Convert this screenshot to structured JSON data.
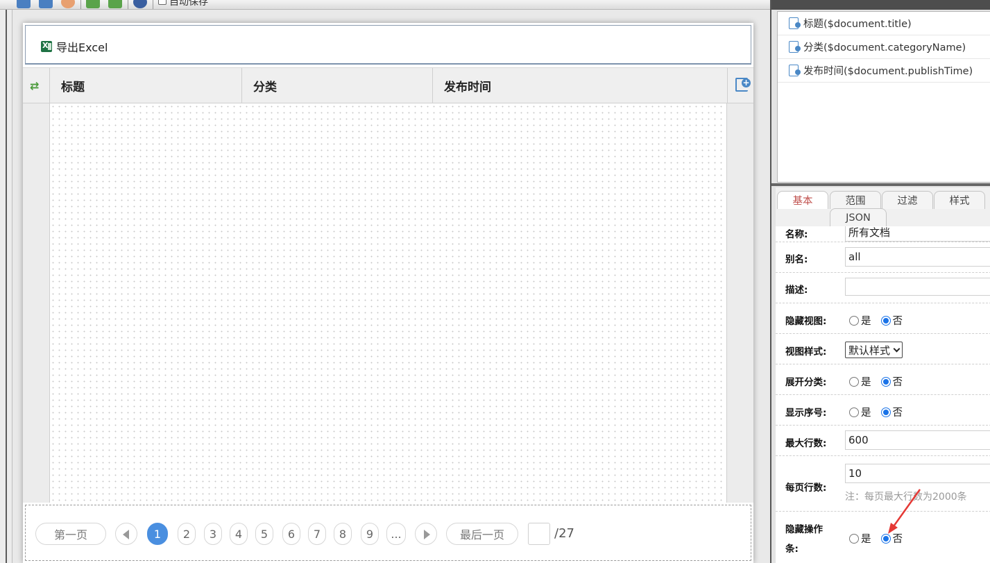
{
  "toolbar": {
    "autosave_label": "自动保存",
    "icons": [
      "save-icon",
      "save-as-icon",
      "preview-icon",
      "import-icon",
      "export-icon",
      "info-icon"
    ]
  },
  "action_bar": {
    "export_button": "导出Excel"
  },
  "grid": {
    "columns": [
      "标题",
      "分类",
      "发布时间"
    ]
  },
  "pager": {
    "first": "第一页",
    "last": "最后一页",
    "pages": [
      "1",
      "2",
      "3",
      "4",
      "5",
      "6",
      "7",
      "8",
      "9",
      "..."
    ],
    "current": "1",
    "total": "/27"
  },
  "fields": [
    "标题($document.title)",
    "分类($document.categoryName)",
    "发布时间($document.publishTime)"
  ],
  "tabs": [
    "基本",
    "范围",
    "过滤",
    "样式",
    "JSON"
  ],
  "active_tab": "基本",
  "props": {
    "name_label": "名称:",
    "name_value": "所有文档",
    "alias_label": "别名:",
    "alias_value": "all",
    "desc_label": "描述:",
    "desc_value": "",
    "hide_view_label": "隐藏视图:",
    "view_style_label": "视图样式:",
    "view_style_value": "默认样式",
    "expand_label": "展开分类:",
    "show_seq_label": "显示序号:",
    "max_rows_label": "最大行数:",
    "max_rows_value": "600",
    "page_rows_label": "每页行数:",
    "page_rows_value": "10",
    "page_rows_note": "注：每页最大行数为2000条",
    "hide_actionbar_label_1": "隐藏操作",
    "hide_actionbar_label_2": "条:",
    "yes": "是",
    "no": "否"
  },
  "colors": {
    "accent": "#4a8fe0",
    "radio_on": "#1a73e8",
    "active_tab_text": "#c0504d",
    "annotation_arrow": "#e53935"
  }
}
